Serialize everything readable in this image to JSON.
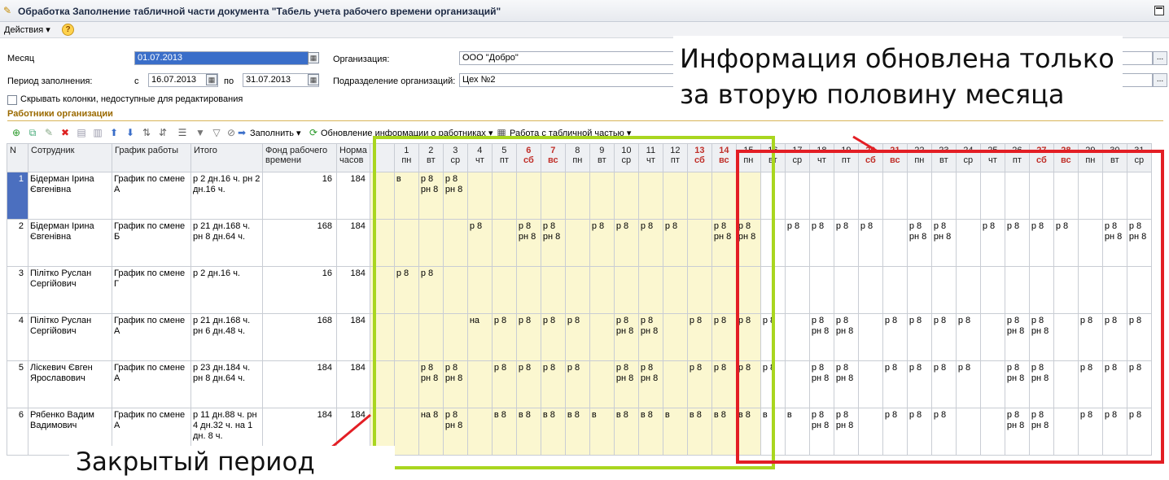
{
  "window": {
    "title": "Обработка  Заполнение табличной части документа \"Табель учета рабочего времени организаций\""
  },
  "menu": {
    "actions_label": "Действия ▾",
    "help_label": "?"
  },
  "form": {
    "month_label": "Месяц",
    "month_value": "01.07.2013",
    "period_label": "Период заполнения:",
    "from_label": "с",
    "from_value": "16.07.2013",
    "to_label": "по",
    "to_value": "31.07.2013",
    "org_label": "Организация:",
    "org_value": "ООО \"Добро\"",
    "dept_label": "Подразделение организаций:",
    "dept_value": "Цех №2",
    "hide_checkbox_label": "Скрывать колонки, недоступные для редактирования",
    "section_title": "Работники организации"
  },
  "toolbar": {
    "fill_label": "Заполнить ▾",
    "update_label": "Обновление информации о работниках ▾",
    "table_label": "Работа с табличной частью ▾"
  },
  "table": {
    "headers": {
      "n": "N",
      "employee": "Сотрудник",
      "schedule": "График работы",
      "total": "Итого",
      "fund": "Фонд рабочего времени",
      "norm": "Норма часов"
    },
    "days": [
      {
        "d": "1",
        "w": "пн"
      },
      {
        "d": "2",
        "w": "вт"
      },
      {
        "d": "3",
        "w": "ср"
      },
      {
        "d": "4",
        "w": "чт"
      },
      {
        "d": "5",
        "w": "пт"
      },
      {
        "d": "6",
        "w": "сб"
      },
      {
        "d": "7",
        "w": "вс"
      },
      {
        "d": "8",
        "w": "пн"
      },
      {
        "d": "9",
        "w": "вт"
      },
      {
        "d": "10",
        "w": "ср"
      },
      {
        "d": "11",
        "w": "чт"
      },
      {
        "d": "12",
        "w": "пт"
      },
      {
        "d": "13",
        "w": "сб"
      },
      {
        "d": "14",
        "w": "вс"
      },
      {
        "d": "15",
        "w": "пн"
      },
      {
        "d": "16",
        "w": "вт"
      },
      {
        "d": "17",
        "w": "ср"
      },
      {
        "d": "18",
        "w": "чт"
      },
      {
        "d": "19",
        "w": "пт"
      },
      {
        "d": "20",
        "w": "сб"
      },
      {
        "d": "21",
        "w": "вс"
      },
      {
        "d": "22",
        "w": "пн"
      },
      {
        "d": "23",
        "w": "вт"
      },
      {
        "d": "24",
        "w": "ср"
      },
      {
        "d": "25",
        "w": "чт"
      },
      {
        "d": "26",
        "w": "пт"
      },
      {
        "d": "27",
        "w": "сб"
      },
      {
        "d": "28",
        "w": "вс"
      },
      {
        "d": "29",
        "w": "пн"
      },
      {
        "d": "30",
        "w": "вт"
      },
      {
        "d": "31",
        "w": "ср"
      }
    ],
    "rows": [
      {
        "n": "1",
        "employee": "Бідерман Ірина Євгенівна",
        "schedule": "График по смене А",
        "total": "р 2 дн.16 ч. рн 2 дн.16 ч.",
        "fund": "16",
        "norm": "184",
        "cells": [
          "в",
          "р 8 рн 8",
          "р 8 рн 8",
          "",
          "",
          "",
          "",
          "",
          "",
          "",
          "",
          "",
          "",
          "",
          "",
          "",
          "",
          "",
          "",
          "",
          "",
          "",
          "",
          "",
          "",
          "",
          "",
          "",
          "",
          "",
          ""
        ]
      },
      {
        "n": "2",
        "employee": "Бідерман Ірина Євгенівна",
        "schedule": "График по смене Б",
        "total": "р 21 дн.168 ч. рн 8 дн.64 ч.",
        "fund": "168",
        "norm": "184",
        "cells": [
          "",
          "",
          "",
          "р 8",
          "",
          "р 8 рн 8",
          "р 8 рн 8",
          "",
          "р 8",
          "р 8",
          "р 8",
          "р 8",
          "",
          "р 8 рн 8",
          "р 8 рн 8",
          "",
          "р 8",
          "р 8",
          "р 8",
          "р 8",
          "",
          "р 8 рн 8",
          "р 8 рн 8",
          "",
          "р 8",
          "р 8",
          "р 8",
          "р 8",
          "",
          "р 8 рн 8",
          "р 8 рн 8"
        ]
      },
      {
        "n": "3",
        "employee": "Пілітко Руслан Сергійович",
        "schedule": "График по смене Г",
        "total": "р 2 дн.16 ч.",
        "fund": "16",
        "norm": "184",
        "cells": [
          "р 8",
          "р 8",
          "",
          "",
          "",
          "",
          "",
          "",
          "",
          "",
          "",
          "",
          "",
          "",
          "",
          "",
          "",
          "",
          "",
          "",
          "",
          "",
          "",
          "",
          "",
          "",
          "",
          "",
          "",
          "",
          ""
        ]
      },
      {
        "n": "4",
        "employee": "Пілітко Руслан Сергійович",
        "schedule": "График по смене А",
        "total": "р 21 дн.168 ч. рн 6 дн.48 ч.",
        "fund": "168",
        "norm": "184",
        "cells": [
          "",
          "",
          "",
          "на",
          "р 8",
          "р 8",
          "р 8",
          "р 8",
          "",
          "р 8 рн 8",
          "р 8 рн 8",
          "",
          "р 8",
          "р 8",
          "р 8",
          "р 8",
          "",
          "р 8 рн 8",
          "р 8 рн 8",
          "",
          "р 8",
          "р 8",
          "р 8",
          "р 8",
          "",
          "р 8 рн 8",
          "р 8 рн 8",
          "",
          "р 8",
          "р 8",
          "р 8"
        ]
      },
      {
        "n": "5",
        "employee": "Ліскевич Євген Ярославович",
        "schedule": "График по смене А",
        "total": "р 23 дн.184 ч. рн 8 дн.64 ч.",
        "fund": "184",
        "norm": "184",
        "cells": [
          "",
          "р 8 рн 8",
          "р 8 рн 8",
          "",
          "р 8",
          "р 8",
          "р 8",
          "р 8",
          "",
          "р 8 рн 8",
          "р 8 рн 8",
          "",
          "р 8",
          "р 8",
          "р 8",
          "р 8",
          "",
          "р 8 рн 8",
          "р 8 рн 8",
          "",
          "р 8",
          "р 8",
          "р 8",
          "р 8",
          "",
          "р 8 рн 8",
          "р 8 рн 8",
          "",
          "р 8",
          "р 8",
          "р 8"
        ]
      },
      {
        "n": "6",
        "employee": "Рябенко Вадим Вадимович",
        "schedule": "График по смене А",
        "total": "р 11 дн.88 ч. рн 4 дн.32 ч. на 1 дн. 8 ч.",
        "fund": "184",
        "norm": "184",
        "cells": [
          "",
          "на 8",
          "р 8 рн 8",
          "",
          "в 8",
          "в 8",
          "в 8",
          "в 8",
          "в",
          "в 8",
          "в 8",
          "в",
          "в 8",
          "в 8",
          "в 8",
          "в",
          "в",
          "р 8 рн 8",
          "р 8 рн 8",
          "",
          "р 8",
          "р 8",
          "р 8",
          "",
          "",
          "р 8 рн 8",
          "р 8 рн 8",
          "",
          "р 8",
          "р 8",
          "р 8"
        ]
      }
    ]
  },
  "annotations": {
    "top_text": "Информация обновлена только за вторую половину месяца",
    "bottom_text": "Закрытый период",
    "green_color": "#a9d61f",
    "red_color": "#e31e24"
  }
}
